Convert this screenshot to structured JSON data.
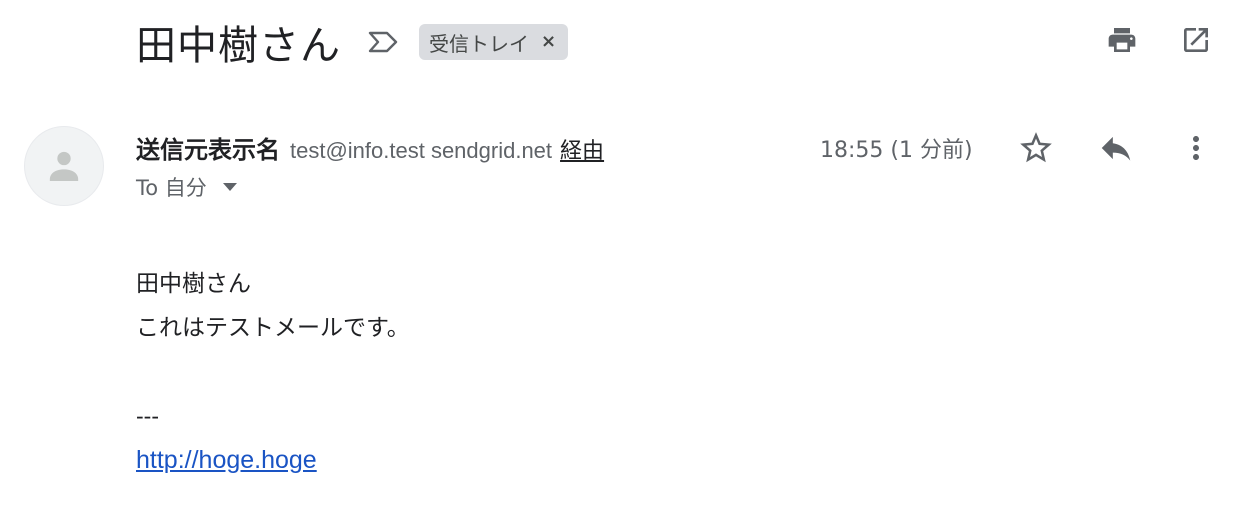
{
  "header": {
    "subject": "田中樹さん",
    "label_chip": "受信トレイ",
    "label_chip_close": "×"
  },
  "sender": {
    "name": "送信元表示名",
    "email": "test@info.test sendgrid.net",
    "via": "経由",
    "recipient": "To 自分",
    "timestamp": "18:55 (1 分前)"
  },
  "body": {
    "line1": "田中樹さん",
    "line2": "これはテストメールです。",
    "signature_separator": "---",
    "link": "http://hoge.hoge"
  },
  "icons": {
    "importance": "importance-marker-icon",
    "print": "print-icon",
    "open_new_window": "open-in-new-icon",
    "avatar": "default-avatar-icon",
    "star": "star-icon",
    "reply": "reply-icon",
    "more": "more-vert-icon",
    "recipient_caret": "caret-down-icon"
  },
  "colors": {
    "link": "#1a54c4",
    "chip_bg": "#dadce0",
    "icon": "#5f6368"
  }
}
